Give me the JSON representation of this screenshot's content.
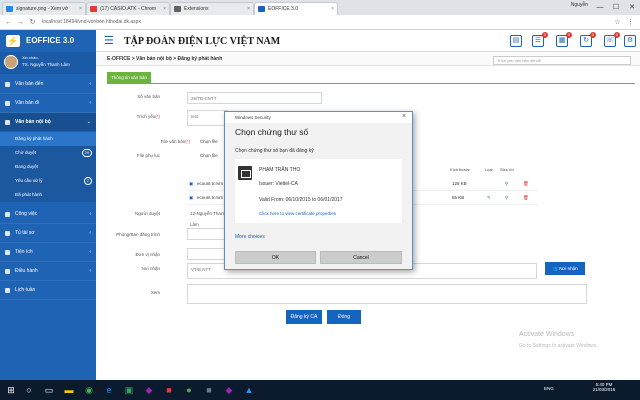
{
  "browser": {
    "tabs": [
      {
        "label": "signature.png - Xem vớ",
        "color": "#1e88e5"
      },
      {
        "label": "(17) CASIO.ATK - Chrom",
        "color": "#e53935"
      },
      {
        "label": "Extensions",
        "color": "#616161"
      },
      {
        "label": "EOFFICE 3.0",
        "color": "#1565c0"
      }
    ],
    "profile": "Nguyễn",
    "address": "localhost:18494/vnd-vonbon.hthodai.dk.aspx",
    "controls": {
      "minimize": "—",
      "maximize": "☐",
      "close": "✕"
    }
  },
  "app": {
    "logo": "EOFFICE 3.0",
    "org_title": "TẬP ĐOÀN ĐIỆN LỰC VIỆT NAM",
    "header_icons": [
      {
        "name": "document-icon",
        "glyph": "▤",
        "badge": ""
      },
      {
        "name": "chat-icon",
        "glyph": "☰",
        "badge": "0"
      },
      {
        "name": "calendar-icon",
        "glyph": "▦",
        "badge": "0"
      },
      {
        "name": "refresh-icon",
        "glyph": "↻",
        "badge": "0"
      },
      {
        "name": "phone-icon",
        "glyph": "☏",
        "badge": "0"
      },
      {
        "name": "settings-icon",
        "glyph": "⚙",
        "badge": ""
      }
    ]
  },
  "user": {
    "greeting": "Xin chào,",
    "name": "TS. Nguyễn Thanh Lâm"
  },
  "sidebar": {
    "items": [
      {
        "label": "Văn bản đến",
        "chevron": "‹"
      },
      {
        "label": "Văn bản đi",
        "chevron": "‹"
      },
      {
        "label": "Văn bản nội bộ",
        "chevron": "⌄"
      }
    ],
    "subitems": [
      {
        "label": "Đăng ký phát hành",
        "badge": ""
      },
      {
        "label": "Chờ duyệt",
        "badge": "29"
      },
      {
        "label": "Đang duyệt",
        "badge": ""
      },
      {
        "label": "Yêu cầu xử lý",
        "badge": "2"
      },
      {
        "label": "Đã phát hành",
        "badge": ""
      }
    ],
    "items2": [
      {
        "label": "Công việc",
        "chevron": "‹"
      },
      {
        "label": "Tủ tài sơ",
        "chevron": "‹"
      },
      {
        "label": "Tiện ích",
        "chevron": "‹"
      },
      {
        "label": "Điều hành",
        "chevron": "‹"
      },
      {
        "label": "Lịch tuần",
        "chevron": ""
      }
    ]
  },
  "breadcrumb": "E-OFFICE > Văn bản nội bộ > Đăng ký phát hành",
  "search_placeholder": "Trích yếu văn bản đến/đi",
  "tab_label": "Thông tin văn bản",
  "form": {
    "so_van_ban_label": "Số văn bản",
    "so_van_ban_value": "26/TB-CNTT",
    "trich_yeu_label": "Trích yếu",
    "trich_yeu_value": "test",
    "file_van_ban_label": "File văn bản",
    "choose_file": "Chọn file",
    "file_phu_luc_label": "File phụ lục",
    "nguoi_duyet_label": "Người duyệt",
    "nguoi_duyet_value": "12-Nguyễn Thanh Lâm",
    "phong_ban_label": "Phòng/Ban đăng trình",
    "don_vi_label": "Đơn vị nhận",
    "noi_nhan_label": "Nơi nhận",
    "noi_nhan_value": "VT/B,NTT",
    "noi_nhan_button": "Nơi nhận",
    "xem_label": "Xem",
    "sign_button": "Đăng ký CA",
    "close_button": "Đóng",
    "required_marker": "(*)"
  },
  "file_table": {
    "headers": {
      "size": "Kích thước",
      "read": "Loại",
      "author": "Sửa Vd"
    },
    "rows": [
      {
        "name": "ecount tr.rvm",
        "size": "126 KB"
      },
      {
        "name": "ecount tr.rvm",
        "size": "85 KB"
      }
    ]
  },
  "dialog": {
    "window_title": "Windows Security",
    "title": "Chọn chứng thư số",
    "subtitle": "Chọn chứng thư số bạn đã đăng ký",
    "cert_name": "PHẠM TRẦN THO",
    "cert_issuer": "Issuer: Viettel-CA",
    "cert_valid": "Valid From: 06/10/2015 to 06/01/2017",
    "cert_link": "Click here to view certificate properties",
    "more_choices": "More choices",
    "ok": "OK",
    "cancel": "Cancel"
  },
  "watermark": {
    "line1": "Activate Windows",
    "line2": "Go to Settings to activate Windows."
  },
  "taskbar": {
    "lang": "ENG",
    "time": "5:40 PM",
    "date": "21/03/2016"
  },
  "colors": {
    "brand": "#1f63b5",
    "accent_green": "#6cb33f",
    "button_blue": "#1565c0"
  }
}
